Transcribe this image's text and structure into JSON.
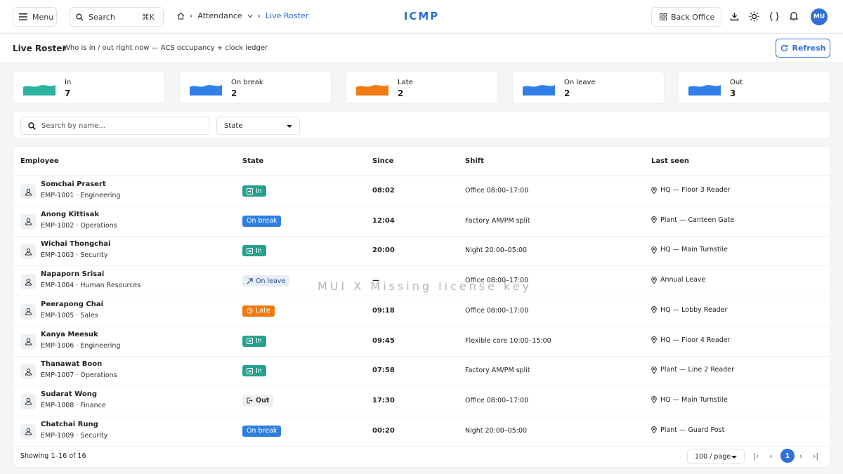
{
  "header": {
    "menu_label": "Menu",
    "search_label": "Search",
    "search_shortcut": "⌘K",
    "breadcrumb": {
      "parent": "Attendance",
      "current": "Live Roster"
    },
    "brand": "ICMP",
    "back_office_label": "Back Office",
    "avatar_initials": "MU"
  },
  "page": {
    "title": "Live Roster",
    "subtitle": "Who is in / out right now — ACS occupancy + clock ledger",
    "refresh_label": "Refresh"
  },
  "stats": [
    {
      "label": "In",
      "value": "7",
      "color": "#2bb39f"
    },
    {
      "label": "On break",
      "value": "2",
      "color": "#2f80e8"
    },
    {
      "label": "Late",
      "value": "2",
      "color": "#f07a12"
    },
    {
      "label": "On leave",
      "value": "2",
      "color": "#2f80e8"
    },
    {
      "label": "Out",
      "value": "3",
      "color": "#2f80e8"
    }
  ],
  "filters": {
    "search_placeholder": "Search by name...",
    "state_label": "State"
  },
  "table": {
    "columns": {
      "employee": "Employee",
      "state": "State",
      "since": "Since",
      "shift": "Shift",
      "last_seen": "Last seen"
    },
    "rows": [
      {
        "name": "Somchai Prasert",
        "meta": "EMP-1001 · Engineering",
        "state": "In",
        "state_key": "in",
        "since": "08:02",
        "shift": "Office 08:00–17:00",
        "last_seen": "HQ — Floor 3 Reader"
      },
      {
        "name": "Anong Kittisak",
        "meta": "EMP-1002 · Operations",
        "state": "On break",
        "state_key": "break",
        "since": "12:04",
        "shift": "Factory AM/PM split",
        "last_seen": "Plant — Canteen Gate"
      },
      {
        "name": "Wichai Thongchai",
        "meta": "EMP-1003 · Security",
        "state": "In",
        "state_key": "in",
        "since": "20:00",
        "shift": "Night 20:00–05:00",
        "last_seen": "HQ — Main Turnstile"
      },
      {
        "name": "Napaporn Srisai",
        "meta": "EMP-1004 · Human Resources",
        "state": "On leave",
        "state_key": "leave",
        "since": "—",
        "shift": "Office 08:00–17:00",
        "last_seen": "Annual Leave"
      },
      {
        "name": "Peerapong Chai",
        "meta": "EMP-1005 · Sales",
        "state": "Late",
        "state_key": "late",
        "since": "09:18",
        "shift": "Office 08:00–17:00",
        "last_seen": "HQ — Lobby Reader"
      },
      {
        "name": "Kanya Meesuk",
        "meta": "EMP-1006 · Engineering",
        "state": "In",
        "state_key": "in",
        "since": "09:45",
        "shift": "Flexible core 10:00–15:00",
        "last_seen": "HQ — Floor 4 Reader"
      },
      {
        "name": "Thanawat Boon",
        "meta": "EMP-1007 · Operations",
        "state": "In",
        "state_key": "in",
        "since": "07:58",
        "shift": "Factory AM/PM split",
        "last_seen": "Plant — Line 2 Reader"
      },
      {
        "name": "Sudarat Wong",
        "meta": "EMP-1008 · Finance",
        "state": "Out",
        "state_key": "out",
        "since": "17:30",
        "shift": "Office 08:00–17:00",
        "last_seen": "HQ — Main Turnstile"
      },
      {
        "name": "Chatchai Rung",
        "meta": "EMP-1009 · Security",
        "state": "On break",
        "state_key": "break",
        "since": "00:20",
        "shift": "Night 20:00–05:00",
        "last_seen": "Plant — Guard Post"
      }
    ]
  },
  "footer": {
    "showing": "Showing 1–16 of 16",
    "per_page": "100 / page",
    "current_page": "1"
  },
  "watermark": "MUI X Missing license key"
}
